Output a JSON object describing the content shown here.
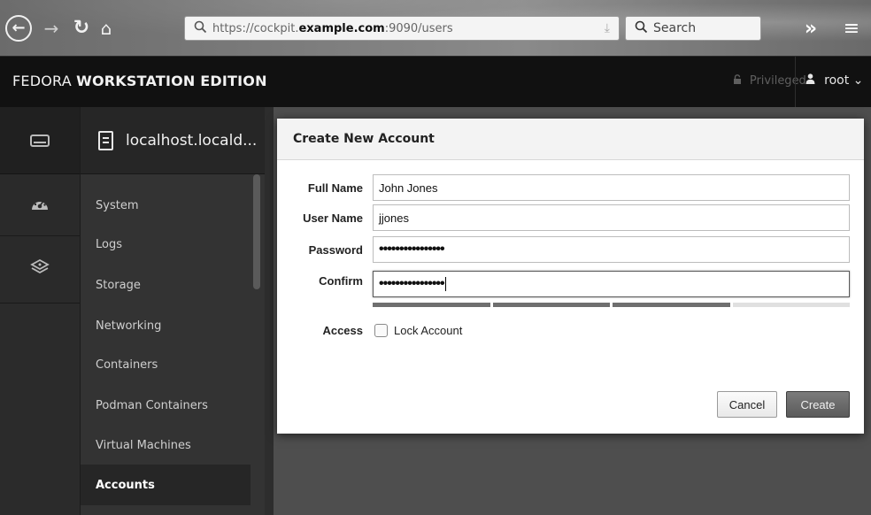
{
  "browser": {
    "back_icon": "←",
    "forward_icon": "→",
    "reload_icon": "↻",
    "home_icon": "⌂",
    "url_prefix": "https://cockpit.",
    "url_host": "example.com",
    "url_suffix": ":9090/users",
    "search_placeholder": "Search",
    "overflow_icon": "»",
    "menu_icon": "≡"
  },
  "header": {
    "brand_light": "FEDORA ",
    "brand_bold": "WORKSTATION EDITION",
    "privileged_label": "Privileged",
    "user_label": "root",
    "user_chevron": "⌄"
  },
  "sidebar": {
    "host_name": "localhost.locald...",
    "items": [
      {
        "label": "System"
      },
      {
        "label": "Logs"
      },
      {
        "label": "Storage"
      },
      {
        "label": "Networking"
      },
      {
        "label": "Containers"
      },
      {
        "label": "Podman Containers"
      },
      {
        "label": "Virtual Machines"
      },
      {
        "label": "Accounts",
        "active": true
      }
    ]
  },
  "dialog": {
    "title": "Create New Account",
    "full_name_label": "Full Name",
    "full_name_value": "John Jones",
    "user_name_label": "User Name",
    "user_name_value": "jjones",
    "password_label": "Password",
    "password_value": "••••••••••••••••",
    "confirm_label": "Confirm",
    "confirm_value": "••••••••••••••••",
    "password_strength_segments_on": 3,
    "password_strength_segments_total": 4,
    "access_label": "Access",
    "lock_account_label": "Lock Account",
    "lock_account_checked": false,
    "cancel_label": "Cancel",
    "create_label": "Create"
  },
  "colors": {
    "header_bg": "#111111",
    "sidebar_bg": "#333333",
    "active_item_bg": "#262626",
    "create_button_bg": "#6b6b6b"
  }
}
